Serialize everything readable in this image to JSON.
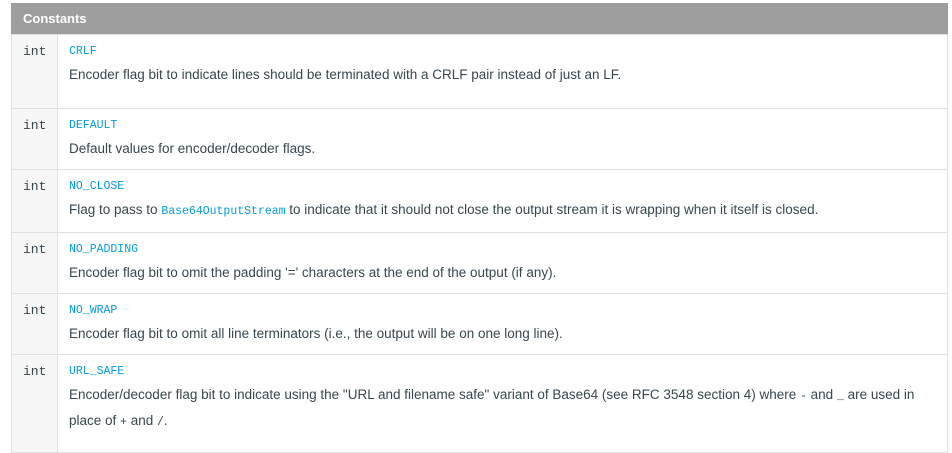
{
  "section": {
    "title": "Constants"
  },
  "rows": [
    {
      "type": "int",
      "name": "CRLF",
      "desc": "Encoder flag bit to indicate lines should be terminated with a CRLF pair instead of just an LF."
    },
    {
      "type": "int",
      "name": "DEFAULT",
      "desc": "Default values for encoder/decoder flags."
    },
    {
      "type": "int",
      "name": "NO_CLOSE",
      "desc_before": "Flag to pass to ",
      "desc_link": "Base64OutputStream",
      "desc_after": " to indicate that it should not close the output stream it is wrapping when it itself is closed."
    },
    {
      "type": "int",
      "name": "NO_PADDING",
      "desc": "Encoder flag bit to omit the padding '=' characters at the end of the output (if any)."
    },
    {
      "type": "int",
      "name": "NO_WRAP",
      "desc": "Encoder flag bit to omit all line terminators (i.e., the output will be on one long line)."
    },
    {
      "type": "int",
      "name": "URL_SAFE",
      "desc_part1": "Encoder/decoder flag bit to indicate using the \"URL and filename safe\" variant of Base64 (see RFC 3548 section 4) where ",
      "desc_code1": "-",
      "desc_part2": " and ",
      "desc_code2": "_",
      "desc_part3": " are used in place of ",
      "desc_code3": "+",
      "desc_part4": " and ",
      "desc_code4": "/",
      "desc_part5": "."
    }
  ]
}
